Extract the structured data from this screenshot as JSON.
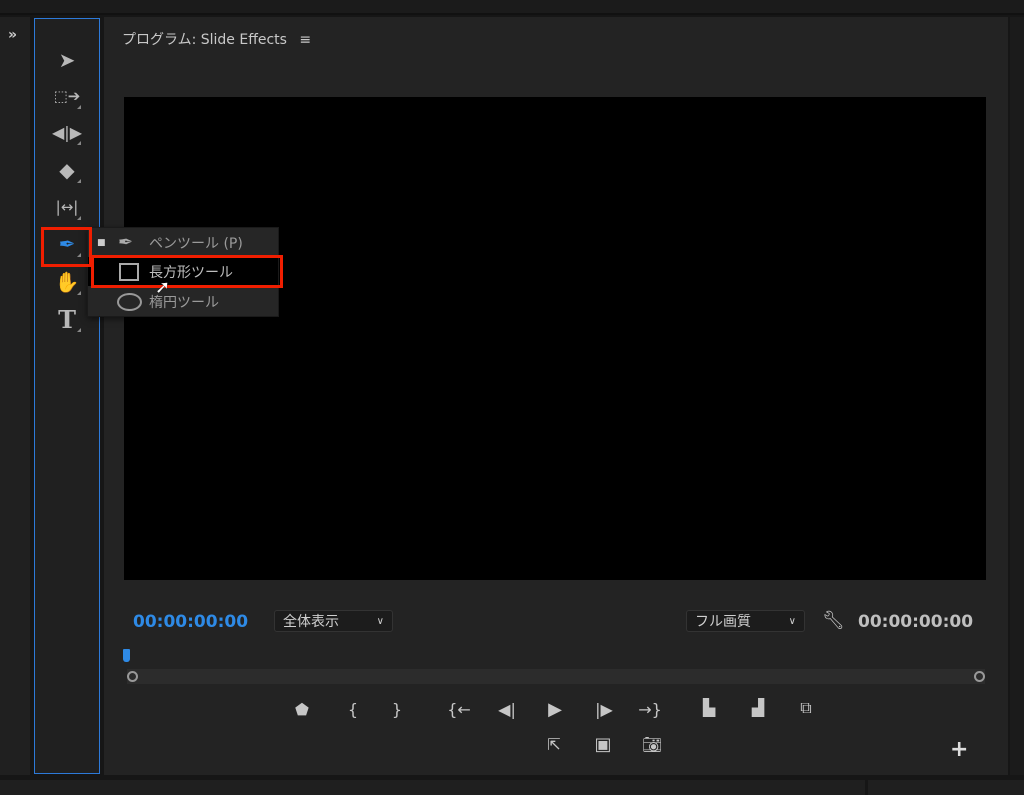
{
  "panel": {
    "title": "プログラム: Slide Effects",
    "menu_icon": "hamburger-icon",
    "expand_icon": "double-chevron-right-icon"
  },
  "tools": [
    {
      "name": "selection-tool",
      "icon": "arrow-icon"
    },
    {
      "name": "track-select-tool",
      "icon": "track-select-icon"
    },
    {
      "name": "ripple-edit-tool",
      "icon": "ripple-icon"
    },
    {
      "name": "razor-tool",
      "icon": "razor-icon"
    },
    {
      "name": "slip-tool",
      "icon": "slip-icon"
    },
    {
      "name": "pen-tool",
      "icon": "pen-icon",
      "active": true
    },
    {
      "name": "hand-tool",
      "icon": "hand-icon"
    },
    {
      "name": "type-tool",
      "icon": "type-icon",
      "label": "T"
    }
  ],
  "flyout": {
    "items": [
      {
        "label": "ペンツール (P)",
        "icon": "pen-icon",
        "selected": true
      },
      {
        "label": "長方形ツール",
        "icon": "rectangle-icon",
        "highlighted": true
      },
      {
        "label": "楕円ツール",
        "icon": "ellipse-icon"
      }
    ]
  },
  "monitor": {
    "timecode_current": "00:00:00:00",
    "timecode_duration": "00:00:00:00",
    "zoom_select": "全体表示",
    "quality_select": "フル画質"
  },
  "colors": {
    "accent": "#2e8ae6",
    "highlight": "#f01e00"
  }
}
